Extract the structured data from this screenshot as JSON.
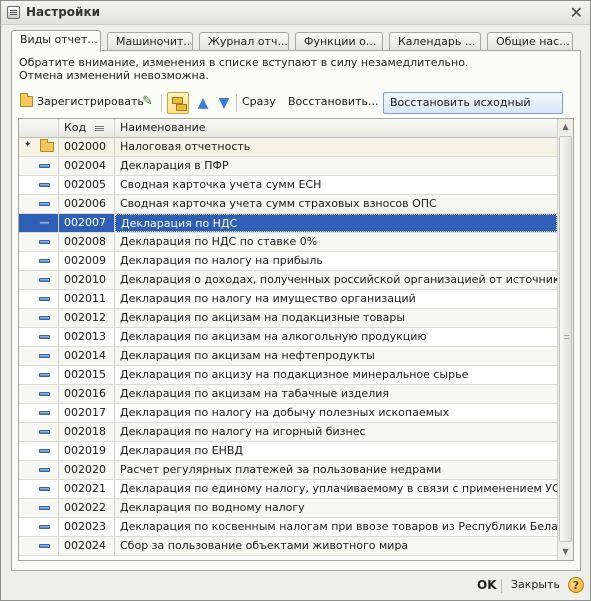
{
  "window": {
    "title": "Настройки",
    "close_glyph": "✕"
  },
  "tabs": [
    {
      "label": "Виды отчет..."
    },
    {
      "label": "Машиночит..."
    },
    {
      "label": "Журнал отч..."
    },
    {
      "label": "Функции о..."
    },
    {
      "label": "Календарь ..."
    },
    {
      "label": "Общие нас..."
    }
  ],
  "notice": {
    "line1": "Обратите внимание, изменения в списке вступают в силу незамедлительно.",
    "line2": "Отмена изменений невозможна."
  },
  "toolbar": {
    "register_label": "Зарегистрировать",
    "view_label": "Сразу",
    "restore_label": "Восстановить...",
    "restore_default_label": "Восстановить исходный список..."
  },
  "table": {
    "col_code": "Код",
    "col_name": "Наименование",
    "rows": [
      {
        "code": "002000",
        "name": "Налоговая отчетность",
        "type": "group"
      },
      {
        "code": "002004",
        "name": "Декларация в ПФР",
        "type": "item"
      },
      {
        "code": "002005",
        "name": "Сводная карточка учета сумм ЕСН",
        "type": "item"
      },
      {
        "code": "002006",
        "name": "Сводная карточка учета сумм страховых взносов ОПС",
        "type": "item"
      },
      {
        "code": "002007",
        "name": "Декларация по НДС",
        "type": "item",
        "selected": true
      },
      {
        "code": "002008",
        "name": "Декларация по НДС по ставке 0%",
        "type": "item"
      },
      {
        "code": "002009",
        "name": "Декларация по налогу на прибыль",
        "type": "item"
      },
      {
        "code": "002010",
        "name": "Декларация о доходах, полученных российской организацией от источников за пр...",
        "type": "item"
      },
      {
        "code": "002011",
        "name": "Декларация по налогу на имущество организаций",
        "type": "item"
      },
      {
        "code": "002012",
        "name": "Декларация по акцизам на подакцизные товары",
        "type": "item"
      },
      {
        "code": "002013",
        "name": "Декларация по акцизам на алкогольную продукцию",
        "type": "item"
      },
      {
        "code": "002014",
        "name": "Декларация по акцизам на нефтепродукты",
        "type": "item"
      },
      {
        "code": "002015",
        "name": "Декларация по акцизу на подакцизное минеральное сырье",
        "type": "item"
      },
      {
        "code": "002016",
        "name": "Декларация по акцизам на табачные изделия",
        "type": "item"
      },
      {
        "code": "002017",
        "name": "Декларация по налогу на добычу полезных ископаемых",
        "type": "item"
      },
      {
        "code": "002018",
        "name": "Декларация по налогу на игорный бизнес",
        "type": "item"
      },
      {
        "code": "002019",
        "name": "Декларация по ЕНВД",
        "type": "item"
      },
      {
        "code": "002020",
        "name": "Расчет регулярных платежей за пользование недрами",
        "type": "item"
      },
      {
        "code": "002021",
        "name": "Декларация по единому налогу, уплачиваемому в связи с применением УСН",
        "type": "item"
      },
      {
        "code": "002022",
        "name": "Декларация по водному налогу",
        "type": "item"
      },
      {
        "code": "002023",
        "name": "Декларация по косвенным налогам при ввозе товаров из Республики Беларусь",
        "type": "item"
      },
      {
        "code": "002024",
        "name": "Сбор за пользование объектами животного мира",
        "type": "item"
      }
    ]
  },
  "footer": {
    "ok_label": "OK",
    "close_label": "Закрыть",
    "help_glyph": "?"
  }
}
